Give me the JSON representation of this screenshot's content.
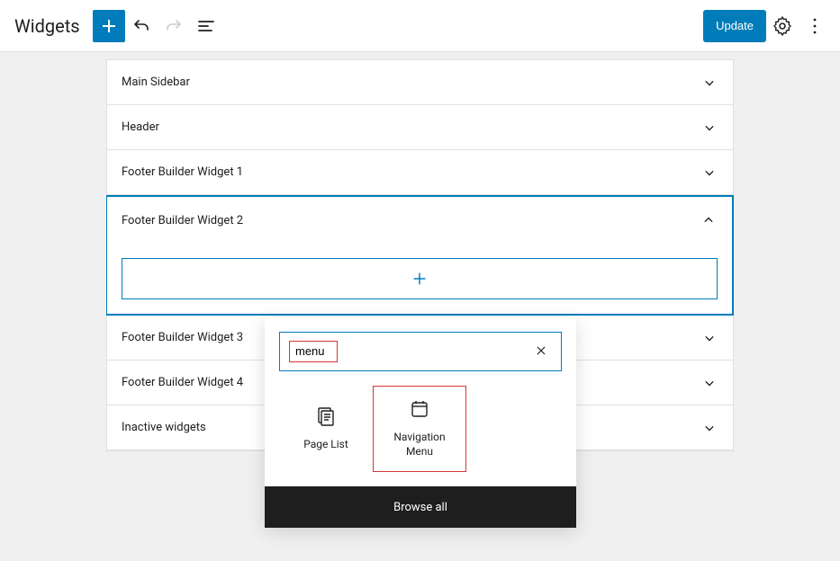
{
  "header": {
    "title": "Widgets",
    "update_label": "Update"
  },
  "areas": [
    {
      "label": "Main Sidebar"
    },
    {
      "label": "Header"
    },
    {
      "label": "Footer Builder Widget 1"
    },
    {
      "label": "Footer Builder Widget 2"
    },
    {
      "label": "Footer Builder Widget 3"
    },
    {
      "label": "Footer Builder Widget 4"
    },
    {
      "label": "Inactive widgets"
    }
  ],
  "inserter": {
    "search_value": "menu",
    "results": [
      {
        "name": "Page List"
      },
      {
        "name": "Navigation Menu"
      }
    ],
    "browse_all_label": "Browse all"
  }
}
